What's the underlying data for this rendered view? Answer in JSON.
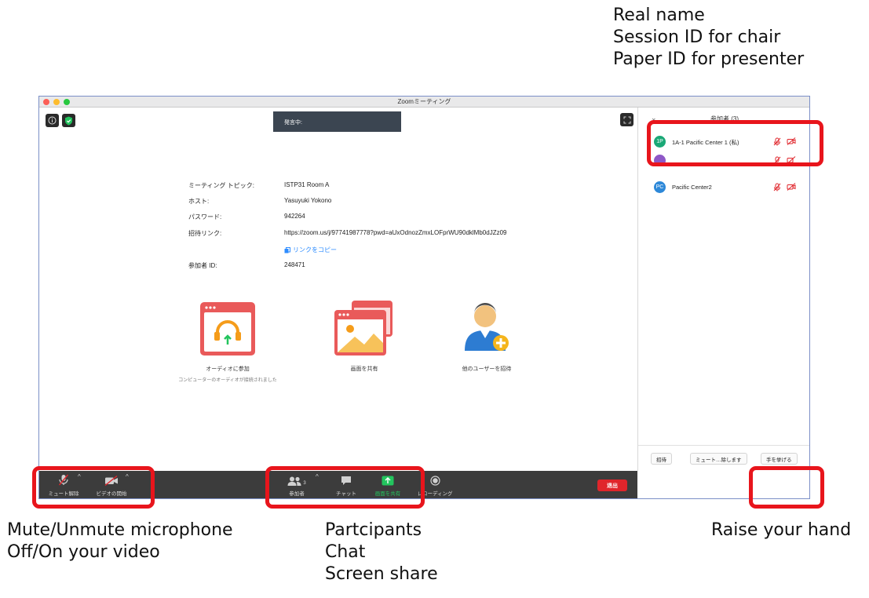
{
  "annotations": {
    "top": [
      "Real name",
      "Session ID for chair",
      "Paper ID for presenter"
    ],
    "left": [
      "Mute/Unmute microphone",
      "Off/On your video"
    ],
    "middle": [
      "Partcipants",
      "Chat",
      "Screen share"
    ],
    "right": [
      "Raise your hand"
    ]
  },
  "window": {
    "title": "Zoomミーティング"
  },
  "main": {
    "speaking_label": "発言中:",
    "info": {
      "topic_label": "ミーティング トピック:",
      "topic_value": "ISTP31 Room A",
      "host_label": "ホスト:",
      "host_value": "Yasuyuki Yokono",
      "password_label": "パスワード:",
      "password_value": "942264",
      "invite_label": "招待リンク:",
      "invite_value": "https://zoom.us/j/97741987778?pwd=aUxOdnozZmxLOFprWU90dklMb0dJZz09",
      "copy_link_label": "リンクをコピー",
      "participant_id_label": "参加者 ID:",
      "participant_id_value": "248471"
    },
    "actions": {
      "join_audio": "オーディオに参加",
      "join_audio_sub": "コンピューターのオーディオが接続されました",
      "share_screen": "画面を共有",
      "invite_others": "他のユーザーを招待"
    }
  },
  "sidebar": {
    "header": "参加者 (3)",
    "participants": [
      {
        "initials": "1P",
        "name": "1A-1 Pacific Center 1 (私)",
        "color": "#1aa876"
      },
      {
        "initials": "",
        "name": "",
        "color": "#8e58c7"
      },
      {
        "initials": "PC",
        "name": "Pacific Center2",
        "color": "#2d88d8"
      }
    ],
    "invite_button": "招待",
    "mute_all_button": "ミュート…除します",
    "raise_hand_button": "手を挙げる"
  },
  "toolbar": {
    "unmute": "ミュート解除",
    "start_video": "ビデオの開始",
    "participants": "参加者",
    "participants_count": "3",
    "chat": "チャット",
    "share_screen": "画面を共有",
    "record": "レコーディング",
    "end": "退出"
  },
  "colors": {
    "highlight": "#e8151c",
    "toolbar_bg": "#3c3c3c",
    "end_red": "#e0252b",
    "share_green": "#23c55e",
    "link_blue": "#2d8cff"
  }
}
